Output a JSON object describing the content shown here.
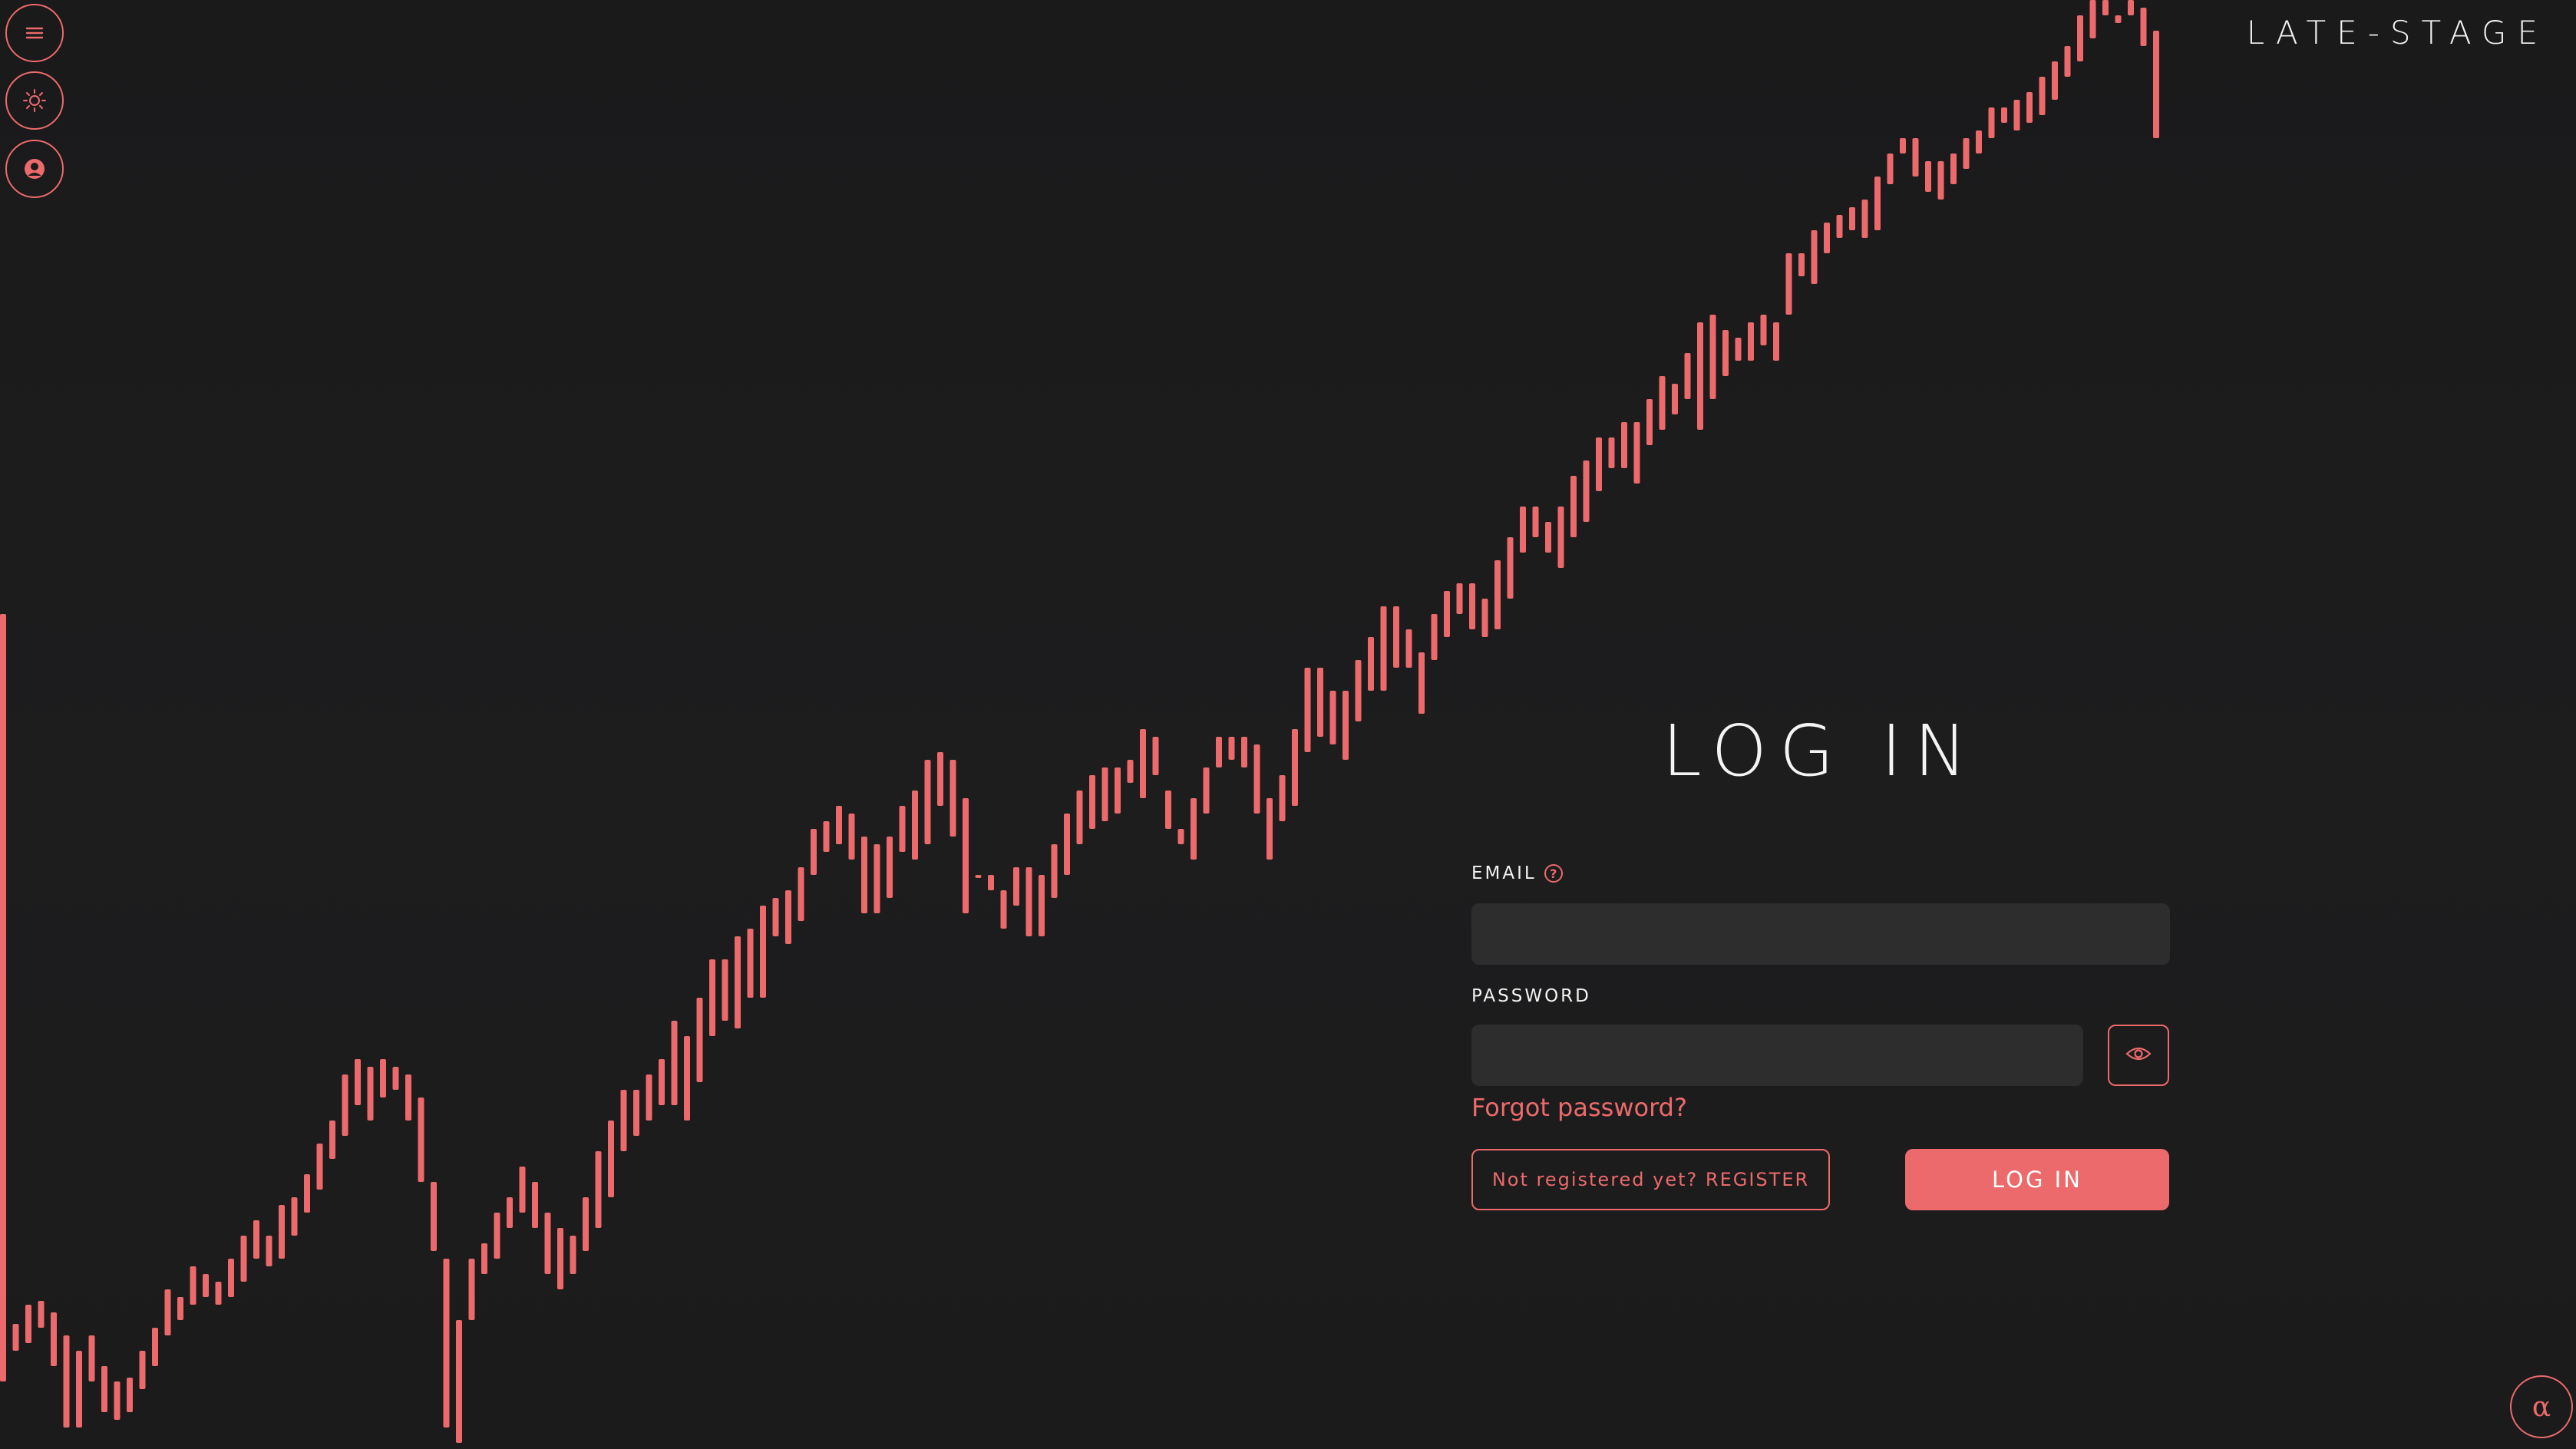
{
  "brand": {
    "name": "LATE-STAGE"
  },
  "controls": {
    "menu_icon": "hamburger-menu-icon",
    "theme_icon": "sun-icon",
    "account_icon": "user-account-icon",
    "alpha_symbol": "α"
  },
  "login": {
    "title": "LOG IN",
    "email_label": "EMAIL",
    "email_value": "",
    "email_placeholder": "",
    "password_label": "PASSWORD",
    "password_value": "",
    "password_placeholder": "",
    "forgot_password": "Forgot password?",
    "register_label": "Not registered yet? REGISTER",
    "submit_label": "LOG IN"
  },
  "colors": {
    "accent": "#ec6a6b",
    "background": "#1b1b1c",
    "input_background": "#2d2d2e",
    "text": "#f2f2f2"
  },
  "background_chart": {
    "type": "bar",
    "ylim": [
      0,
      1888
    ],
    "ohlc": [
      [
        800,
        1800
      ],
      [
        1725,
        1760
      ],
      [
        1700,
        1750
      ],
      [
        1695,
        1730
      ],
      [
        1710,
        1780
      ],
      [
        1740,
        1860
      ],
      [
        1760,
        1860
      ],
      [
        1740,
        1800
      ],
      [
        1780,
        1840
      ],
      [
        1800,
        1850
      ],
      [
        1795,
        1840
      ],
      [
        1760,
        1810
      ],
      [
        1730,
        1780
      ],
      [
        1680,
        1740
      ],
      [
        1690,
        1720
      ],
      [
        1650,
        1700
      ],
      [
        1660,
        1690
      ],
      [
        1670,
        1700
      ],
      [
        1640,
        1690
      ],
      [
        1610,
        1670
      ],
      [
        1590,
        1640
      ],
      [
        1610,
        1650
      ],
      [
        1570,
        1640
      ],
      [
        1560,
        1610
      ],
      [
        1530,
        1580
      ],
      [
        1490,
        1550
      ],
      [
        1460,
        1510
      ],
      [
        1400,
        1480
      ],
      [
        1380,
        1440
      ],
      [
        1390,
        1460
      ],
      [
        1380,
        1430
      ],
      [
        1390,
        1420
      ],
      [
        1400,
        1460
      ],
      [
        1430,
        1540
      ],
      [
        1540,
        1630
      ],
      [
        1640,
        1860
      ],
      [
        1880,
        1720
      ],
      [
        1720,
        1640
      ],
      [
        1620,
        1660
      ],
      [
        1580,
        1640
      ],
      [
        1560,
        1600
      ],
      [
        1520,
        1580
      ],
      [
        1540,
        1600
      ],
      [
        1580,
        1660
      ],
      [
        1600,
        1680
      ],
      [
        1610,
        1660
      ],
      [
        1560,
        1630
      ],
      [
        1500,
        1600
      ],
      [
        1460,
        1560
      ],
      [
        1420,
        1500
      ],
      [
        1420,
        1480
      ],
      [
        1400,
        1460
      ],
      [
        1380,
        1440
      ],
      [
        1330,
        1440
      ],
      [
        1350,
        1460
      ],
      [
        1300,
        1410
      ],
      [
        1250,
        1350
      ],
      [
        1250,
        1330
      ],
      [
        1220,
        1340
      ],
      [
        1210,
        1300
      ],
      [
        1180,
        1300
      ],
      [
        1170,
        1220
      ],
      [
        1160,
        1230
      ],
      [
        1130,
        1200
      ],
      [
        1080,
        1140
      ],
      [
        1070,
        1110
      ],
      [
        1050,
        1100
      ],
      [
        1060,
        1120
      ],
      [
        1090,
        1190
      ],
      [
        1100,
        1190
      ],
      [
        1090,
        1170
      ],
      [
        1050,
        1110
      ],
      [
        1030,
        1120
      ],
      [
        990,
        1100
      ],
      [
        980,
        1050
      ],
      [
        990,
        1090
      ],
      [
        1040,
        1190
      ],
      [
        1140,
        1140
      ],
      [
        1140,
        1160
      ],
      [
        1160,
        1210
      ],
      [
        1130,
        1180
      ],
      [
        1130,
        1220
      ],
      [
        1140,
        1220
      ],
      [
        1100,
        1170
      ],
      [
        1060,
        1140
      ],
      [
        1030,
        1100
      ],
      [
        1010,
        1080
      ],
      [
        1000,
        1070
      ],
      [
        1000,
        1060
      ],
      [
        990,
        1020
      ],
      [
        950,
        1040
      ],
      [
        960,
        1010
      ],
      [
        1030,
        1080
      ],
      [
        1080,
        1100
      ],
      [
        1040,
        1120
      ],
      [
        1000,
        1060
      ],
      [
        960,
        1000
      ],
      [
        960,
        990
      ],
      [
        960,
        1000
      ],
      [
        970,
        1060
      ],
      [
        1040,
        1120
      ],
      [
        1010,
        1070
      ],
      [
        950,
        1050
      ],
      [
        870,
        980
      ],
      [
        870,
        960
      ],
      [
        900,
        970
      ],
      [
        900,
        990
      ],
      [
        860,
        940
      ],
      [
        830,
        900
      ],
      [
        790,
        900
      ],
      [
        790,
        870
      ],
      [
        820,
        870
      ],
      [
        850,
        930
      ],
      [
        800,
        860
      ],
      [
        770,
        830
      ],
      [
        760,
        800
      ],
      [
        760,
        820
      ],
      [
        780,
        830
      ],
      [
        730,
        820
      ],
      [
        700,
        780
      ],
      [
        660,
        720
      ],
      [
        660,
        700
      ],
      [
        680,
        720
      ],
      [
        660,
        740
      ],
      [
        620,
        700
      ],
      [
        600,
        680
      ],
      [
        570,
        640
      ],
      [
        570,
        610
      ],
      [
        550,
        610
      ],
      [
        550,
        630
      ],
      [
        520,
        580
      ],
      [
        490,
        560
      ],
      [
        500,
        540
      ],
      [
        460,
        520
      ],
      [
        420,
        560
      ],
      [
        410,
        520
      ],
      [
        430,
        490
      ],
      [
        440,
        470
      ],
      [
        420,
        470
      ],
      [
        410,
        450
      ],
      [
        420,
        470
      ],
      [
        330,
        410
      ],
      [
        330,
        360
      ],
      [
        300,
        370
      ],
      [
        290,
        330
      ],
      [
        280,
        310
      ],
      [
        270,
        300
      ],
      [
        260,
        310
      ],
      [
        230,
        300
      ],
      [
        200,
        240
      ],
      [
        180,
        200
      ],
      [
        180,
        230
      ],
      [
        210,
        250
      ],
      [
        210,
        260
      ],
      [
        200,
        240
      ],
      [
        180,
        220
      ],
      [
        170,
        200
      ],
      [
        140,
        180
      ],
      [
        140,
        160
      ],
      [
        130,
        170
      ],
      [
        120,
        160
      ],
      [
        100,
        150
      ],
      [
        80,
        130
      ],
      [
        60,
        100
      ],
      [
        20,
        80
      ],
      [
        0,
        50
      ],
      [
        0,
        20
      ],
      [
        20,
        30
      ],
      [
        0,
        20
      ],
      [
        10,
        60
      ],
      [
        40,
        180
      ]
    ]
  }
}
